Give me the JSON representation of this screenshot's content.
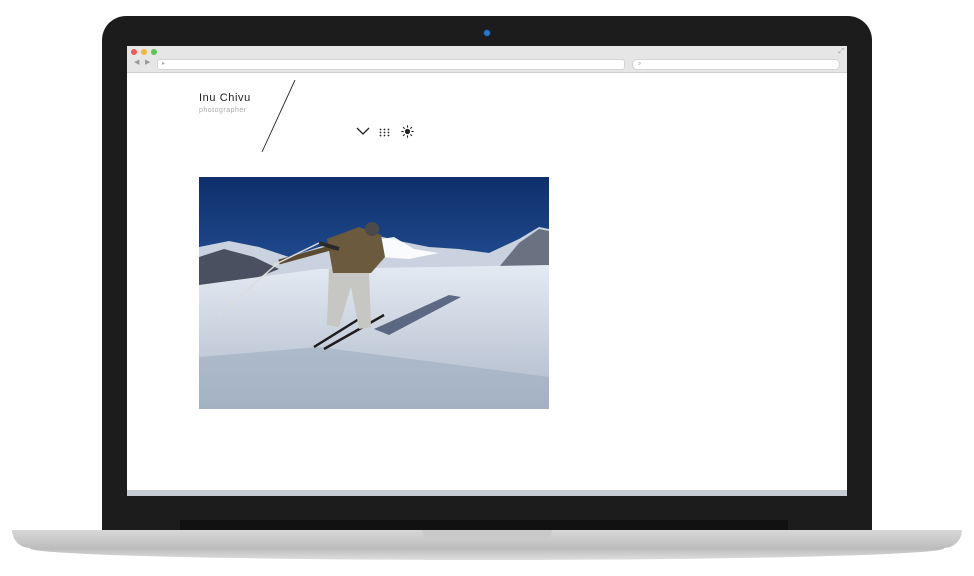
{
  "browser": {
    "window_controls": [
      "close",
      "minimize",
      "zoom"
    ],
    "url": "",
    "search_placeholder": ""
  },
  "site": {
    "title": "Inu Chivu",
    "subtitle": "photographer"
  },
  "toolbar": {
    "icons": [
      "chevron-down-icon",
      "grid-dots-icon",
      "sun-icon"
    ]
  },
  "photo": {
    "subject": "skier"
  },
  "colors": {
    "sky": "#1f4a8c",
    "snow": "#e9eef5",
    "laptop_bezel": "#1c1c1c",
    "laptop_base": "#c9c9c9"
  }
}
